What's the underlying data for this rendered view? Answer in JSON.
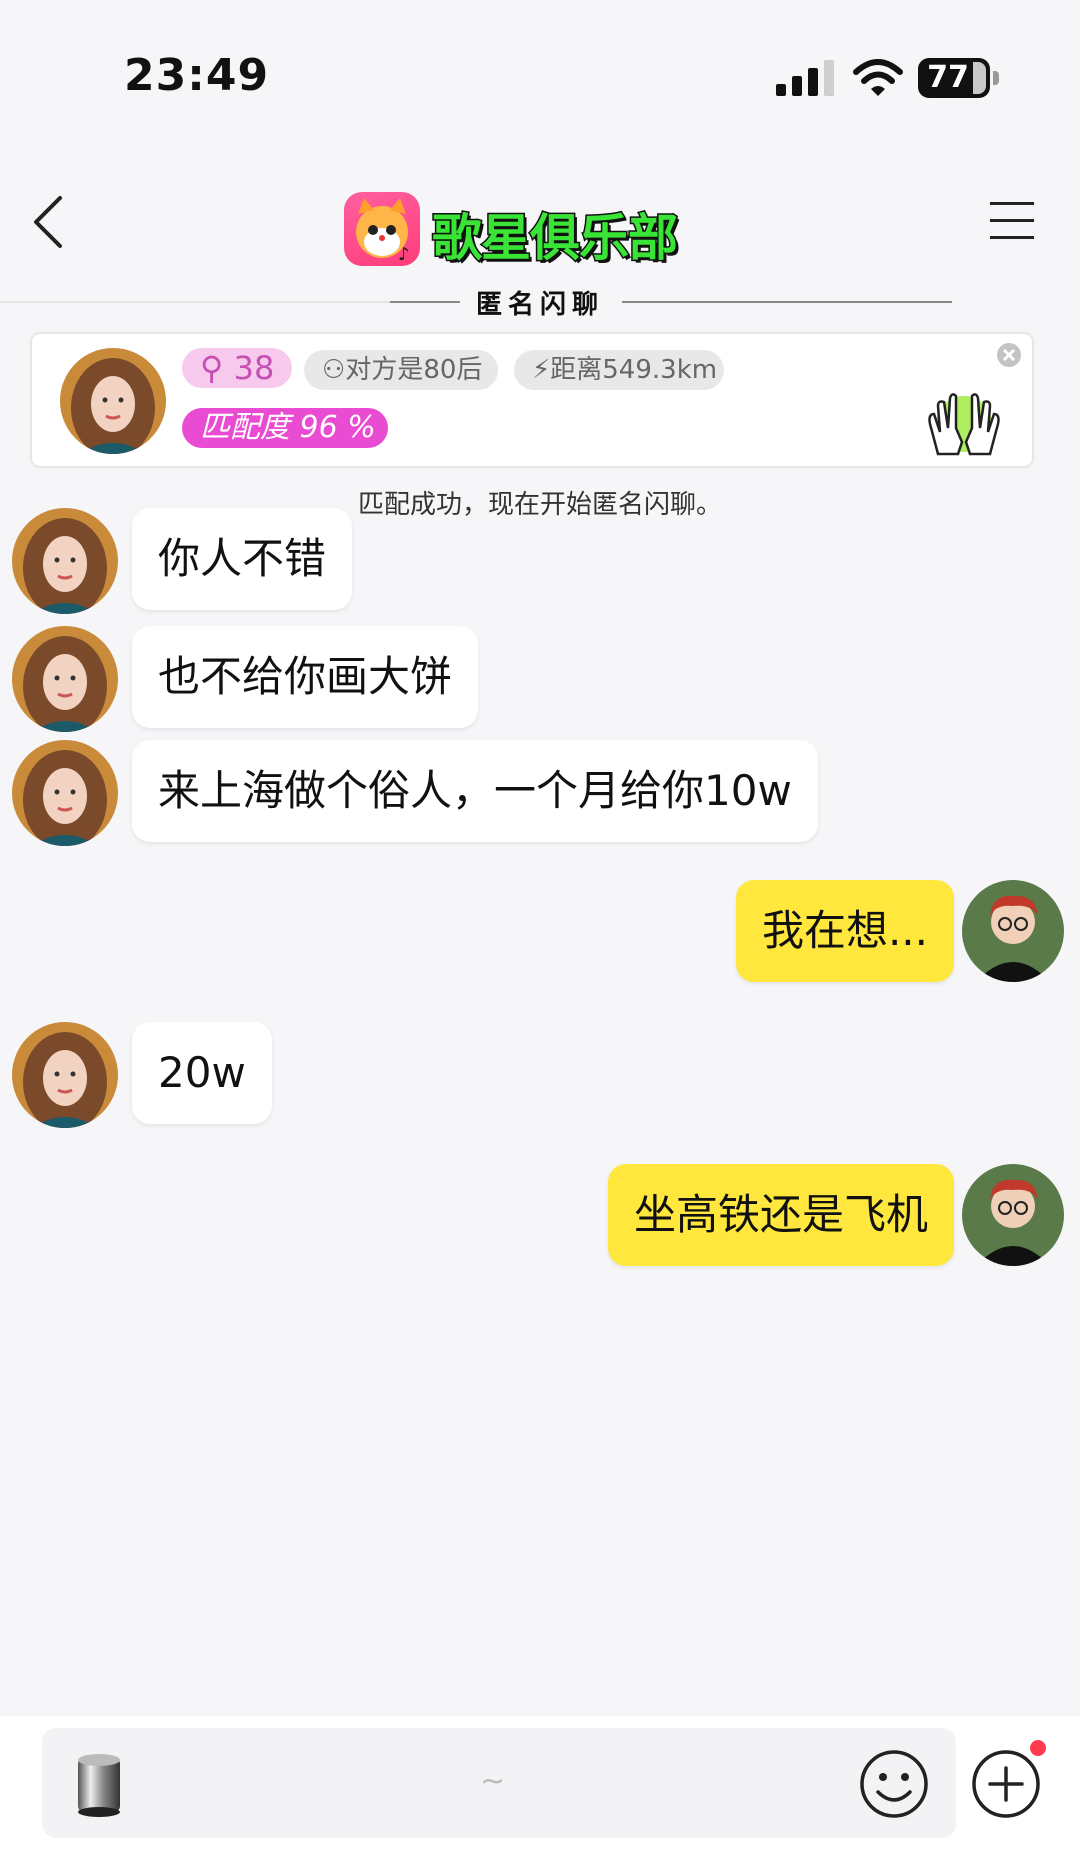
{
  "status_bar": {
    "time": "23:49",
    "battery": "77"
  },
  "nav": {
    "brand": "歌星俱乐部",
    "subtitle": "匿名闪聊"
  },
  "match_card": {
    "age": "38",
    "age_icon": "female-icon",
    "era": "对方是80后",
    "distance": "距离549.3km",
    "match_label": "匹配度 96 %",
    "match_fraction": 0.96
  },
  "system_message": "匹配成功，现在开始匿名闪聊。",
  "messages": [
    {
      "from": "her",
      "text": "你人不错"
    },
    {
      "from": "her",
      "text": "也不给你画大饼"
    },
    {
      "from": "her",
      "text": "来上海做个俗人，一个月给你10w"
    },
    {
      "from": "me",
      "text": "我在想..."
    },
    {
      "from": "her",
      "text": "20w"
    },
    {
      "from": "me",
      "text": "坐高铁还是飞机"
    }
  ],
  "input": {
    "placeholder": "~"
  },
  "colors": {
    "my_bubble": "#ffe73d",
    "her_bubble": "#ffffff",
    "match_badge": "#e94bd2",
    "brand_green": "#39e436"
  }
}
